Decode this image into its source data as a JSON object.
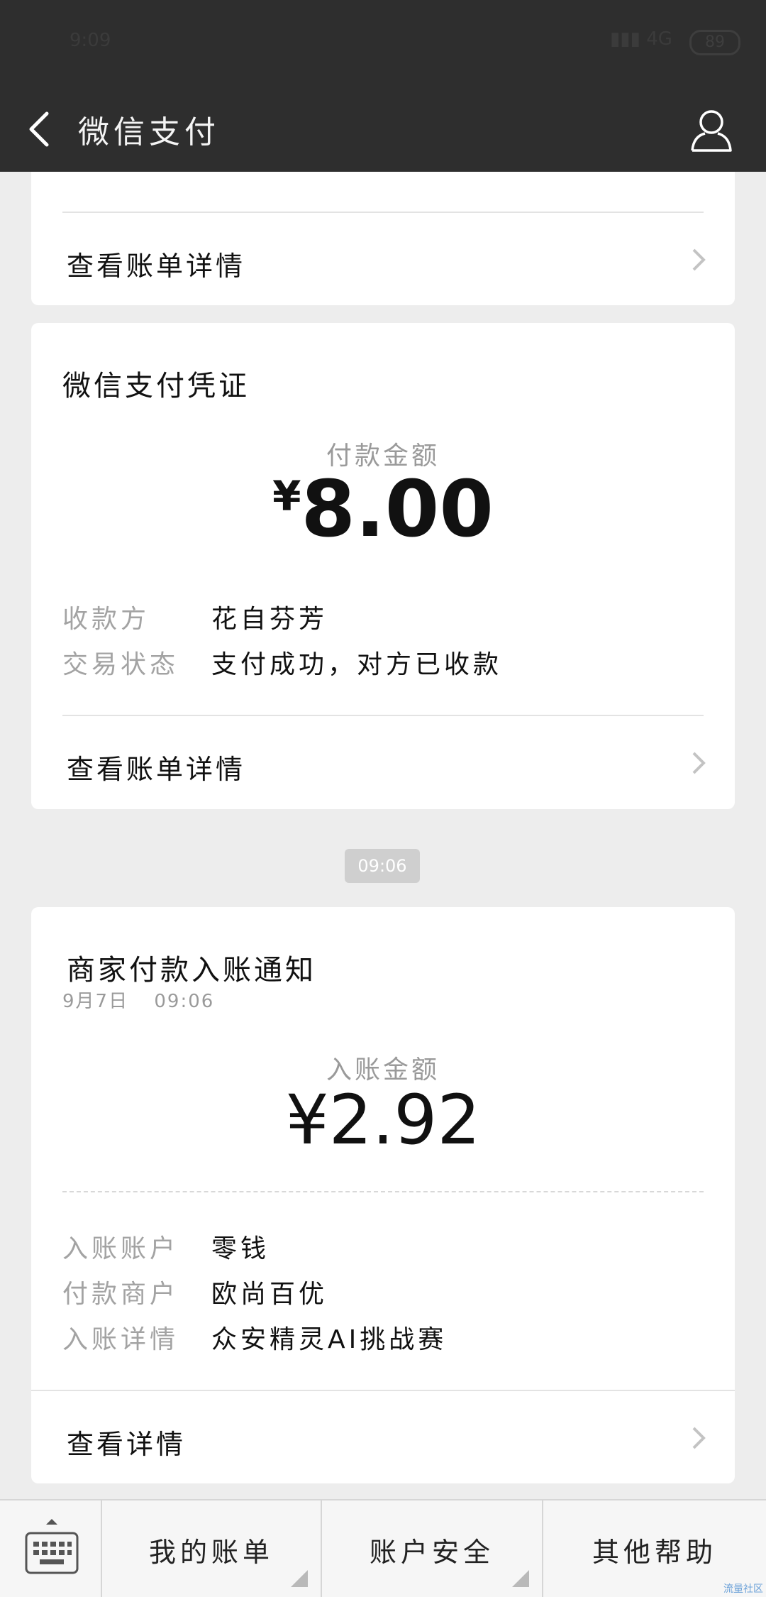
{
  "status_bar": {
    "time": "9:09",
    "network": "4G",
    "battery": "89"
  },
  "nav": {
    "title": "微信支付"
  },
  "card1": {
    "link_label": "查看账单详情"
  },
  "card2": {
    "title": "微信支付凭证",
    "amount_caption": "付款金额",
    "currency": "¥",
    "amount": "8.00",
    "fields": [
      {
        "key": "收款方",
        "value": "花自芬芳"
      },
      {
        "key": "交易状态",
        "value": "支付成功，对方已收款"
      }
    ],
    "link_label": "查看账单详情"
  },
  "timestamp": "09:06",
  "card3": {
    "title": "商家付款入账通知",
    "date": "9月7日",
    "time": "09:06",
    "amount_caption": "入账金额",
    "amount": "¥2.92",
    "fields": [
      {
        "key": "入账账户",
        "value": "零钱"
      },
      {
        "key": "付款商户",
        "value": "欧尚百优"
      },
      {
        "key": "入账详情",
        "value": "众安精灵AI挑战赛"
      }
    ],
    "link_label": "查看详情"
  },
  "bottom_menu": {
    "items": [
      {
        "label": "我的账单"
      },
      {
        "label": "账户安全"
      },
      {
        "label": "其他帮助"
      }
    ]
  },
  "watermark": "流量社区"
}
